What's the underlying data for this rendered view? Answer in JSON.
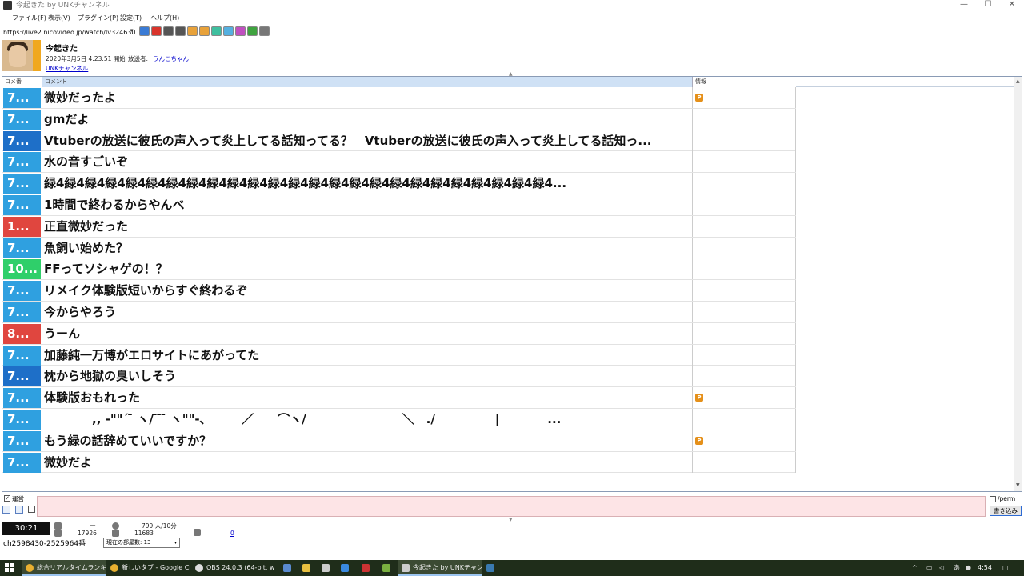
{
  "window": {
    "title": "今起きた by UNKチャンネル",
    "controls": [
      "—",
      "☐",
      "✕"
    ]
  },
  "menu": [
    "ファイル(F)",
    "表示(V)",
    "プラグイン(P)",
    "設定(T)",
    "ヘルプ(H)"
  ],
  "address": {
    "value": "https://live2.nicovideo.jp/watch/lv324630"
  },
  "toolbar_colors": [
    "#3a7bd5",
    "#d9342b",
    "#555555",
    "#555555",
    "#e8a23a",
    "#e8a23a",
    "#3fbf9f",
    "#55b0e0",
    "#c050c0",
    "#3fa33f",
    "#777777"
  ],
  "info": {
    "title": "今起きた",
    "date": "2020年3月5日 4:23:51 開始",
    "broadcaster_label": "放送者:",
    "broadcaster": "うんこちゃん",
    "channel": "UNKチャンネル"
  },
  "grid": {
    "headers": {
      "no": "コメ番",
      "comment": "コメント",
      "info": "情報"
    },
    "rows": [
      {
        "no": "7...",
        "color": "#2fa0e0",
        "comment": "微妙だったよ",
        "premium": true
      },
      {
        "no": "7...",
        "color": "#2fa0e0",
        "comment": "gmだよ",
        "premium": false
      },
      {
        "no": "7...",
        "color": "#1e6fc8",
        "comment": "Vtuberの放送に彼氏の声入って炎上してる話知ってる？　Vtuberの放送に彼氏の声入って炎上してる話知っ...",
        "premium": false
      },
      {
        "no": "7...",
        "color": "#2fa0e0",
        "comment": "水の音すごいぞ",
        "premium": false
      },
      {
        "no": "7...",
        "color": "#2fa0e0",
        "comment": "緑4緑4緑4緑4緑4緑4緑4緑4緑4緑4緑4緑4緑4緑4緑4緑4緑4緑4緑4緑4緑4緑4緑4緑4緑4...",
        "premium": false
      },
      {
        "no": "7...",
        "color": "#2fa0e0",
        "comment": "1時間で終わるからやんべ",
        "premium": false
      },
      {
        "no": "1...",
        "color": "#e0463f",
        "comment": "正直微妙だった",
        "premium": false
      },
      {
        "no": "7...",
        "color": "#2fa0e0",
        "comment": "魚飼い始めた？",
        "premium": false
      },
      {
        "no": "10...",
        "color": "#2fcf6a",
        "comment": "FFってソシャゲの！？",
        "premium": false
      },
      {
        "no": "7...",
        "color": "#2fa0e0",
        "comment": "リメイク体験版短いからすぐ終わるぞ",
        "premium": false
      },
      {
        "no": "7...",
        "color": "#2fa0e0",
        "comment": "今からやろう",
        "premium": false
      },
      {
        "no": "8...",
        "color": "#e0463f",
        "comment": "うーん",
        "premium": false
      },
      {
        "no": "7...",
        "color": "#2fa0e0",
        "comment": "加藤純一万博がエロサイトにあがってた",
        "premium": false
      },
      {
        "no": "7...",
        "color": "#1e6fc8",
        "comment": "枕から地獄の臭いしそう",
        "premium": false
      },
      {
        "no": "7...",
        "color": "#2fa0e0",
        "comment": "体験版おもれった",
        "premium": true
      },
      {
        "no": "7...",
        "color": "#2fa0e0",
        "comment": "　　　　,, -\"\"´ ̄ ヽ/ ̄ ̄ ̄ ヽ\"\"-､　　　／　　⌒ヽ/　　　　　　　　＼　./　　　　　|　　　　...",
        "premium": false
      },
      {
        "no": "7...",
        "color": "#2fa0e0",
        "comment": "もう緑の話辞めていいですか？",
        "premium": true
      },
      {
        "no": "7...",
        "color": "#2fa0e0",
        "comment": "微妙だよ",
        "premium": false
      }
    ],
    "premium_label": "P"
  },
  "input": {
    "unei_label": "運営",
    "perm_label": "/perm",
    "submit_label": "書き込み"
  },
  "status": {
    "timer": "30:21",
    "comment_dash": "—",
    "comment_count": "17926",
    "viewers_per10": "799 人/10分",
    "viewers": "11683",
    "zero": "0",
    "channel_range": "ch2598430-2525964番",
    "room": "現在の部屋数: 13"
  },
  "taskbar": {
    "tasks": [
      {
        "label": "総合リアルタイムランキン...",
        "active": true
      },
      {
        "label": "新しいタブ - Google Ch...",
        "active": false
      },
      {
        "label": "OBS 24.0.3 (64-bit, wi...",
        "active": false
      },
      {
        "label": "今起きた by UNKチャン...",
        "active": true
      }
    ],
    "time": "4:54",
    "ime": "あ"
  }
}
